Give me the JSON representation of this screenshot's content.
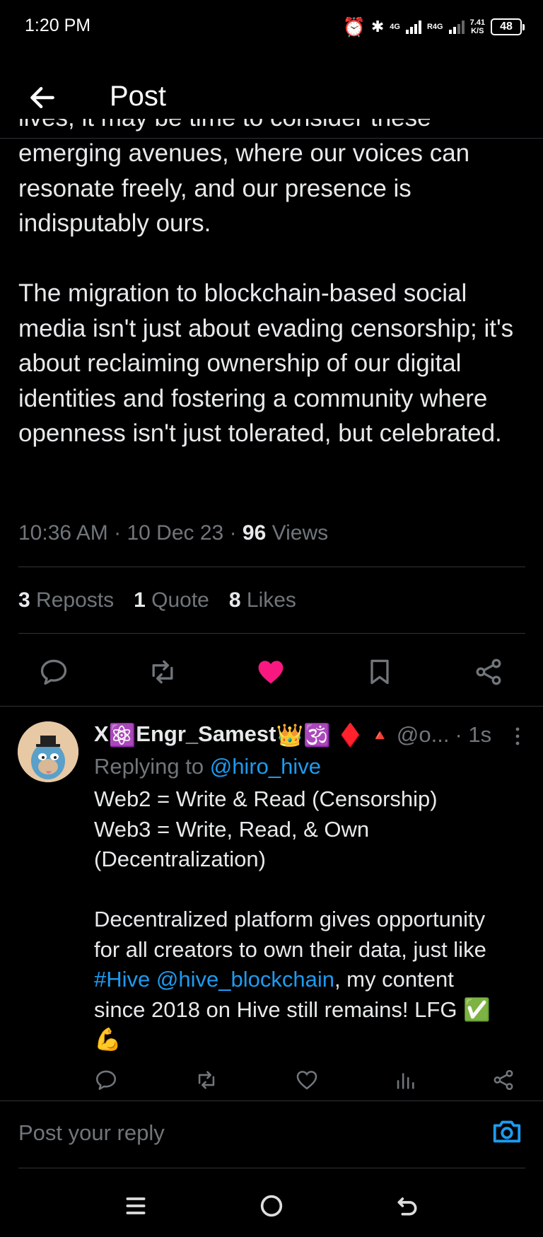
{
  "status_bar": {
    "time": "1:20 PM",
    "network_1": "4G",
    "network_2": "R4G",
    "speed_value": "7.41",
    "speed_unit": "K/S",
    "battery": "48",
    "icons": [
      "alarm-icon",
      "bluetooth-icon",
      "signal-icon",
      "battery-icon"
    ]
  },
  "header": {
    "title": "Post",
    "back_icon": "arrow-left-icon"
  },
  "post": {
    "clipped_line": "lives, it may be time to consider these",
    "paragraph_1": "emerging avenues, where our voices can resonate freely, and our presence is indisputably ours.",
    "paragraph_2": "The migration to blockchain-based social media isn't just about evading censorship; it's about reclaiming ownership of our digital identities and fostering a community where openness isn't just tolerated, but celebrated.",
    "time": "10:36 AM",
    "date": "10 Dec 23",
    "views_count": "96",
    "views_label": "Views",
    "separator": "·"
  },
  "stats": {
    "reposts_count": "3",
    "reposts_label": "Reposts",
    "quotes_count": "1",
    "quotes_label": "Quote",
    "likes_count": "8",
    "likes_label": "Likes"
  },
  "post_actions": {
    "liked": true,
    "like_color": "#f91880",
    "icons": [
      "reply-icon",
      "repost-icon",
      "heart-icon",
      "bookmark-icon",
      "share-icon"
    ]
  },
  "reply": {
    "name_prefix": "X",
    "name_main": "Engr_Samest",
    "emoji_atom": "⚛️",
    "emoji_crown": "👑",
    "emoji_om": "🕉️",
    "emoji_diamond": "♦️",
    "emoji_triangle": "🔺",
    "handle": "@o...",
    "time": "· 1s",
    "replying_to_label": "Replying to",
    "replying_to_handle": "@hiro_hive",
    "line_1": "Web2 = Write & Read (Censorship)",
    "line_2": "Web3 = Write, Read, & Own",
    "line_3": "(Decentralization)",
    "line_4": "Decentralized platform gives opportunity",
    "line_5": "for all creators to own their data, just like",
    "hashtag": "#Hive",
    "mention": "@hive_blockchain",
    "line_6_rest": ", my content",
    "line_7": "since 2018 on Hive still remains! LFG ✅",
    "line_8": "💪"
  },
  "reply_actions": {
    "icons": [
      "reply-icon",
      "repost-icon",
      "heart-icon",
      "analytics-icon",
      "share-icon"
    ]
  },
  "composer": {
    "placeholder": "Post your reply",
    "accent": "#1d9bf0"
  },
  "navbar": {
    "icons": [
      "menu-icon",
      "home-circle-icon",
      "back-icon"
    ]
  }
}
